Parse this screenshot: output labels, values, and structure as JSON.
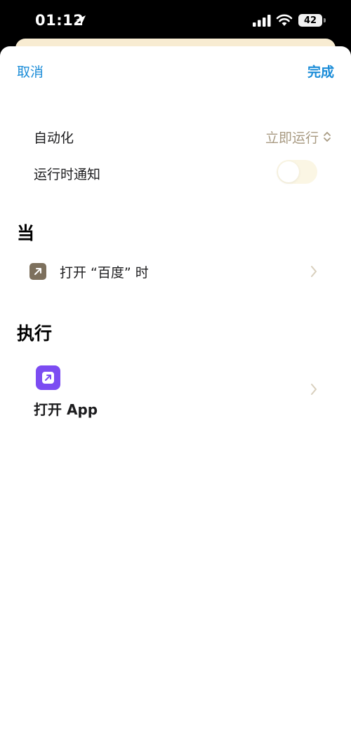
{
  "status_bar": {
    "time": "01:12",
    "battery": "42",
    "icons": [
      "location-arrow-icon",
      "signal-icon",
      "wifi-icon",
      "battery-icon"
    ]
  },
  "nav": {
    "cancel": "取消",
    "done": "完成"
  },
  "settings": {
    "automation_label": "自动化",
    "automation_value": "立即运行",
    "notify_label": "运行时通知",
    "notify_on": false
  },
  "when": {
    "title": "当",
    "trigger": "打开 “百度” 时"
  },
  "do": {
    "title": "执行",
    "action": "打开 App"
  },
  "colors": {
    "accent": "#1a8cd8",
    "value_text": "#a89a82",
    "trigger_icon_bg": "#7d705d",
    "action_icon_bg": "#7c4cf2",
    "toggle_off_bg": "#fbf6e4"
  }
}
